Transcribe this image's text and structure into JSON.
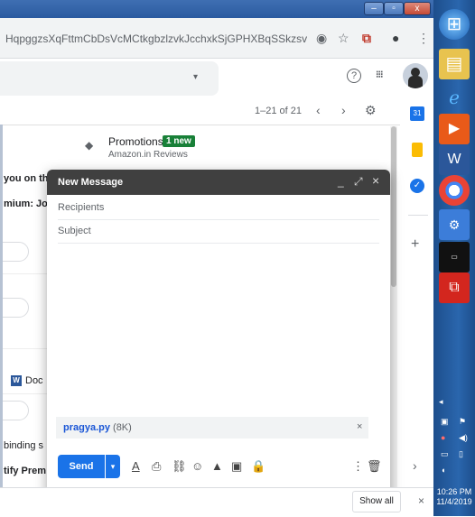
{
  "browser": {
    "url": "HqpggzsXqFttmCbDsVcMCtkgbzlzvkJcchxkSjGPHXBqSSkzsv",
    "window_controls": {
      "minimize": "–",
      "maximize": "▫",
      "close": "x"
    },
    "icons": [
      "eye-icon",
      "star-icon",
      "pdf-extension-icon",
      "profile-icon",
      "menu-icon"
    ]
  },
  "gmail_header": {
    "search_dropdown_icon": "▾",
    "help_icon": "?",
    "apps_icon": "⋮⋮⋮"
  },
  "toolbar": {
    "page_count": "1–21 of 21",
    "prev": "‹",
    "next": "›",
    "settings": "⚙"
  },
  "inbox": {
    "promotions": {
      "title": "Promotions",
      "badge": "1 new",
      "subtitle": "Amazon.in Reviews"
    },
    "fragments": [
      {
        "text": "you on th",
        "bold": true
      },
      {
        "text": "mium: Jo",
        "bold": true
      },
      {
        "text": "Doc",
        "bold": false
      },
      {
        "text": "binding s",
        "bold": false
      },
      {
        "text": "tify Prem",
        "bold": true
      }
    ],
    "doc_badge": "W"
  },
  "compose": {
    "title": "New Message",
    "controls": {
      "minimize": "_",
      "expand": "⤢",
      "close": "×"
    },
    "recipients_placeholder": "Recipients",
    "subject_placeholder": "Subject",
    "attachment": {
      "name": "pragya.py",
      "size": "(8K)",
      "remove": "×"
    },
    "send_label": "Send",
    "send_more": "▾",
    "more_options": "⋮",
    "discard": "🗑"
  },
  "downloads_bar": {
    "show_all": "Show all",
    "close": "×"
  },
  "taskbar": {
    "time": "10:26 PM",
    "date": "11/4/2019"
  },
  "colors": {
    "send_blue": "#1a73e8",
    "compose_header": "#404040",
    "promo_badge": "#188038"
  }
}
